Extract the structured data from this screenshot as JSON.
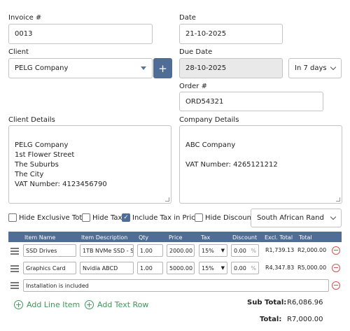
{
  "invoice": {
    "label": "Invoice #",
    "value": "0013"
  },
  "date": {
    "label": "Date",
    "value": "21-10-2025"
  },
  "client": {
    "label": "Client",
    "value": "PELG Company",
    "add_label": "+"
  },
  "due_date": {
    "label": "Due Date",
    "value": "28-10-2025",
    "term": "In 7 days"
  },
  "order": {
    "label": "Order #",
    "value": "ORD54321"
  },
  "client_details": {
    "label": "Client Details",
    "text": "PELG Company\n1st Flower Street\nThe Suburbs\nThe City\nVAT Number: 4123456790"
  },
  "company_details": {
    "label": "Company Details",
    "text": "ABC Company\n\nVAT Number: 4265121212"
  },
  "options": {
    "hide_exclusive_total": {
      "label": "Hide Exclusive Total",
      "checked": false
    },
    "hide_tax": {
      "label": "Hide Tax",
      "checked": false
    },
    "include_tax_in_price": {
      "label": "Include Tax in Price",
      "checked": true
    },
    "hide_discount": {
      "label": "Hide Discount",
      "checked": false
    },
    "currency": "South African Rand"
  },
  "table": {
    "headers": [
      "Item Name",
      "Item Description",
      "Qty",
      "Price",
      "Tax",
      "Discount",
      "Excl. Total",
      "Total"
    ],
    "rows": [
      {
        "name": "SSD Drives",
        "description": "1TB NVMe SSD - Se",
        "qty": "1.00",
        "price": "2000.00",
        "tax": "15%",
        "discount": "0.00",
        "discount_unit": "%",
        "excl_total": "R1,739.13",
        "total": "R2,000.00"
      },
      {
        "name": "Graphics Card",
        "description": "Nvidia ABCD",
        "qty": "1.00",
        "price": "5000.00",
        "tax": "15%",
        "discount": "0.00",
        "discount_unit": "%",
        "excl_total": "R4,347.83",
        "total": "R5,000.00"
      }
    ],
    "text_row": "Installation is included"
  },
  "actions": {
    "add_line_item": "Add Line Item",
    "add_text_row": "Add Text Row"
  },
  "totals": {
    "sub_total_label": "Sub Total:",
    "sub_total_value": "R6,086.96",
    "total_label": "Total:",
    "total_value": "R7,000.00"
  },
  "colors": {
    "accent": "#4f6d96",
    "add_green": "#3a9a56",
    "remove_red": "#d9534f"
  }
}
